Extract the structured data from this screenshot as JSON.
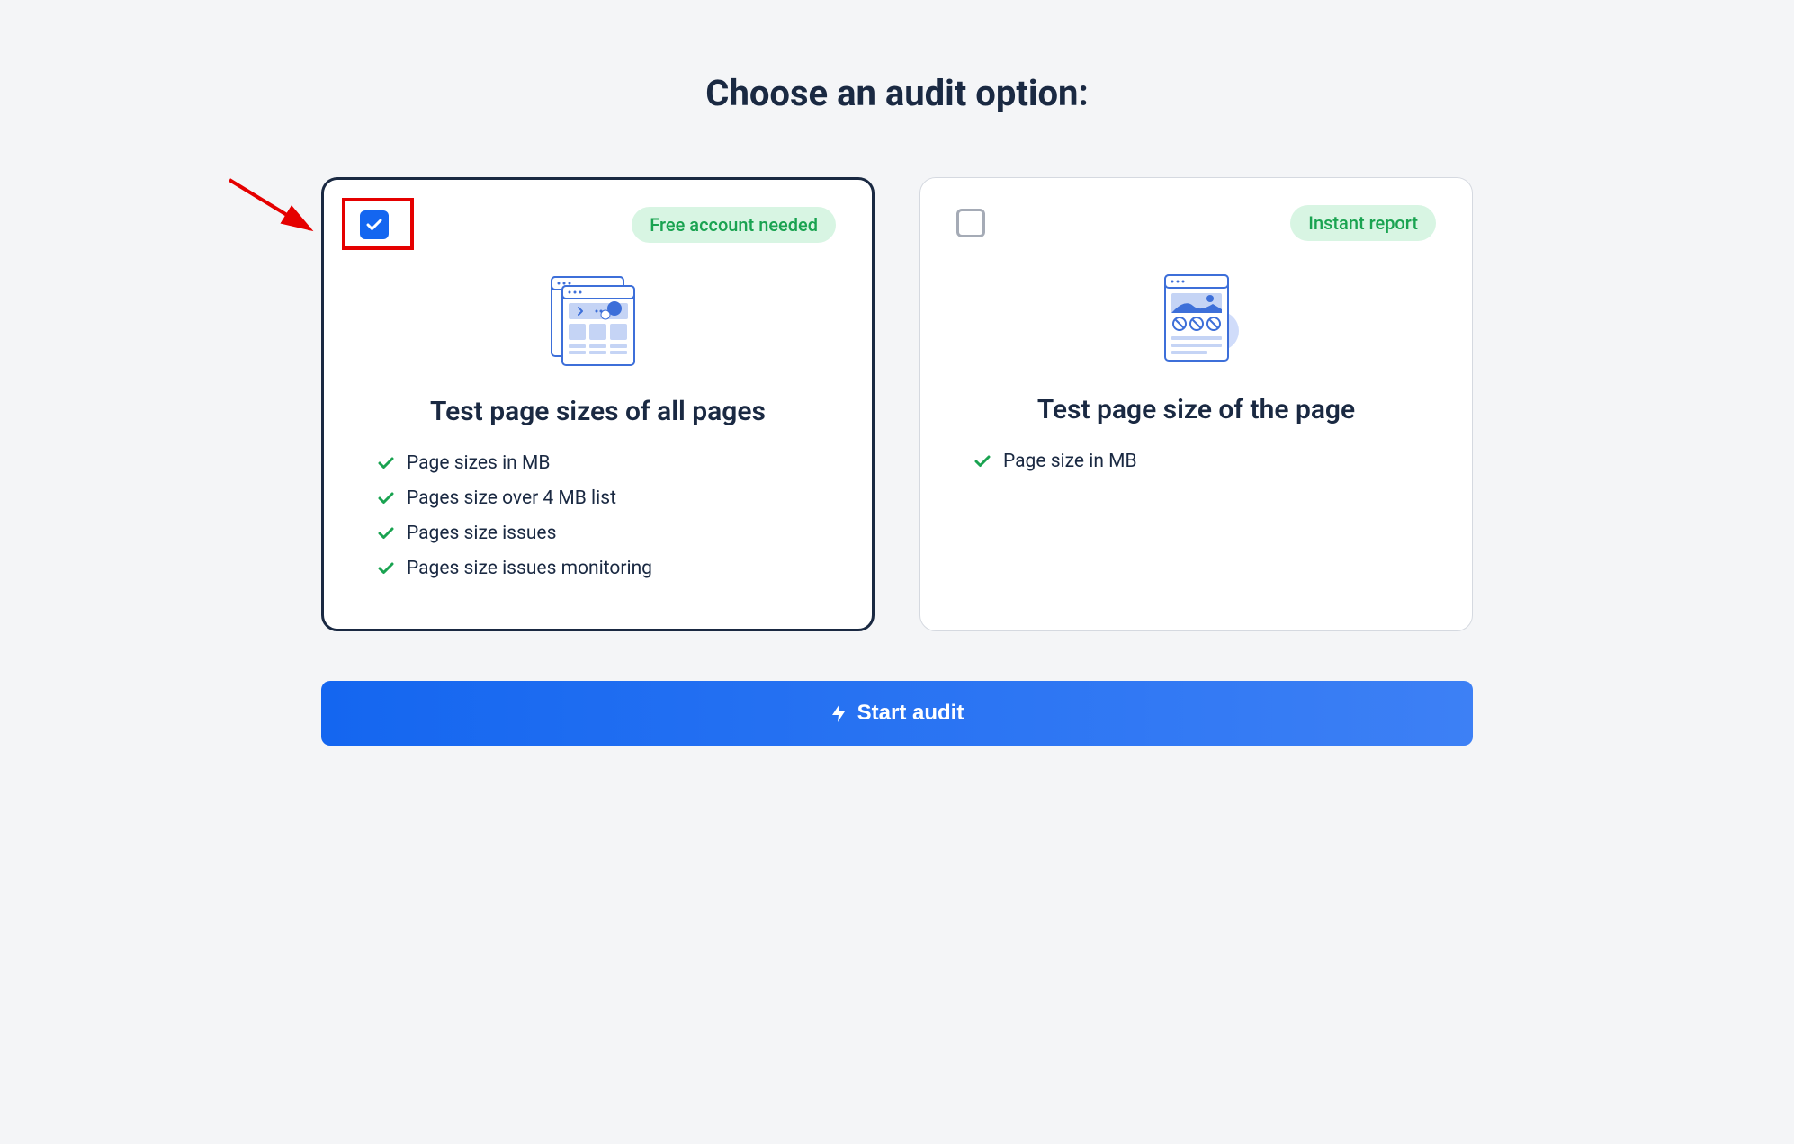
{
  "title": "Choose an audit option:",
  "options": [
    {
      "selected": true,
      "badge": "Free account needed",
      "title": "Test page sizes of all pages",
      "features": [
        "Page sizes in MB",
        "Pages size over 4 MB list",
        "Pages size issues",
        "Pages size issues monitoring"
      ]
    },
    {
      "selected": false,
      "badge": "Instant report",
      "title": "Test page size of the page",
      "features": [
        "Page size in MB"
      ]
    }
  ],
  "button_label": "Start audit"
}
